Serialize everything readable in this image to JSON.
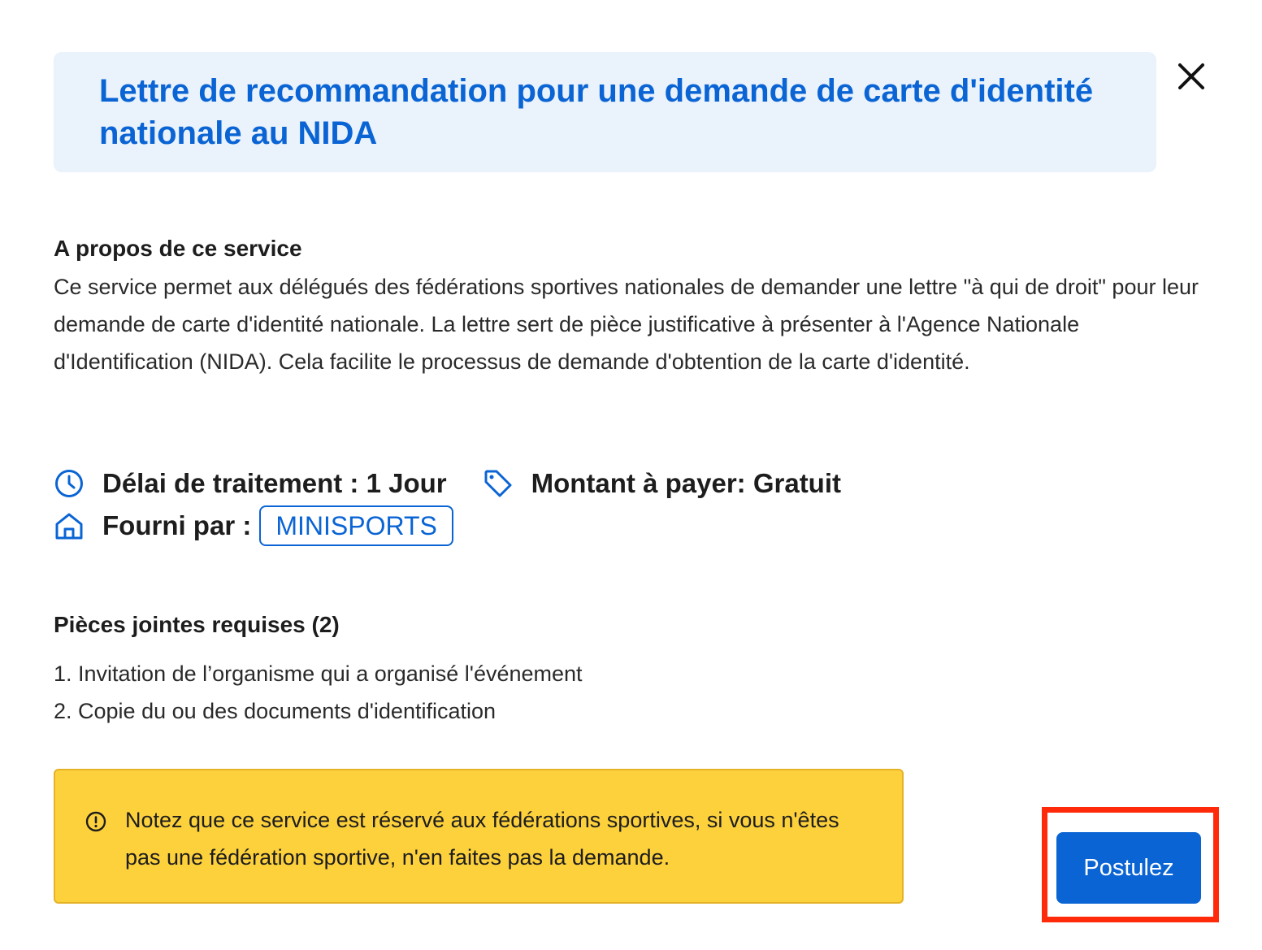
{
  "dialog": {
    "title": "Lettre de recommandation pour une demande de carte d'identité nationale au NIDA",
    "close_icon": "close-icon"
  },
  "about": {
    "heading": "A propos de ce service",
    "text": "Ce service permet aux délégués des fédérations sportives nationales de demander une lettre \"à qui de droit\" pour leur demande de carte d'identité nationale. La lettre sert de pièce justificative à présenter à l'Agence Nationale d'Identification (NIDA). Cela facilite le processus de demande d'obtention de la carte d'identité."
  },
  "meta": {
    "processing_time": "Délai de traitement : 1 Jour",
    "amount": "Montant à payer: Gratuit",
    "provided_by_label": "Fourni par :",
    "provider": "MINISPORTS",
    "icons": {
      "processing_time": "clock-icon",
      "amount": "tag-icon",
      "provider": "home-icon"
    }
  },
  "attachments": {
    "heading": "Pièces jointes requises (2)",
    "items": [
      "1. Invitation de l’organisme qui a organisé l'événement",
      "2. Copie du ou des documents d'identification"
    ]
  },
  "notice": {
    "icon": "alert-circle-icon",
    "text": "Notez que ce service est réservé aux fédérations sportives, si vous n'êtes pas une fédération sportive, n'en faites pas la demande."
  },
  "actions": {
    "apply_label": "Postulez"
  },
  "colors": {
    "accent": "#0a64d4",
    "header_bg": "#eaf2fc",
    "notice_bg": "#fdd13c",
    "highlight": "#ff2a0a"
  }
}
